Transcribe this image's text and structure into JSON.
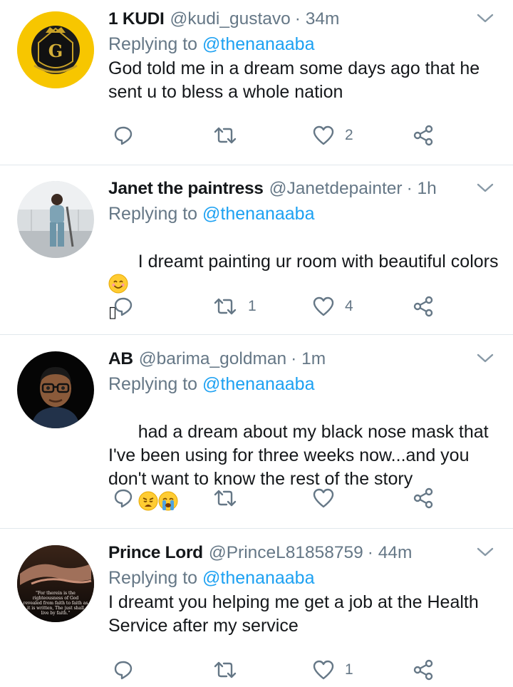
{
  "tweets": [
    {
      "name": "1 KUDI",
      "handle": "@kudi_gustavo",
      "time": "· 34m",
      "reply_prefix": "Replying to",
      "reply_to": "@thenanaaba",
      "text": "God told me in a dream some days ago that he sent u to bless a whole nation",
      "retweets": "",
      "likes": "2",
      "avatar": "gold-crest-logo"
    },
    {
      "name": "Janet the paintress",
      "handle": "@Janetdepainter",
      "time": "· 1h",
      "reply_prefix": "Replying to",
      "reply_to": "@thenanaaba",
      "text": "I dreamt painting ur room with beautiful colors",
      "text_tail": "▯",
      "retweets": "1",
      "likes": "4",
      "avatar": "person-photo"
    },
    {
      "name": "AB",
      "handle": "@barima_goldman",
      "time": "· 1m",
      "reply_prefix": "Replying to",
      "reply_to": "@thenanaaba",
      "text": "had a dream about my black nose mask that I've been using for three weeks now...and you don't want to know the rest of the story",
      "retweets": "",
      "likes": "",
      "avatar": "memoji"
    },
    {
      "name": "Prince Lord",
      "handle": "@PrinceL81858759",
      "time": "· 44m",
      "reply_prefix": "Replying to",
      "reply_to": "@thenanaaba",
      "text": "I dreamt you helping me get a job at the Health Service after my service",
      "retweets": "",
      "likes": "1",
      "avatar": "hands-scripture",
      "avatar_text": "\"For therein is the righteousness of God revealed from faith to faith as it is written, The just shall live by faith.\""
    }
  ],
  "icons": {
    "reply": "reply-icon",
    "retweet": "retweet-icon",
    "like": "heart-icon",
    "share": "share-icon",
    "more": "chevron-down-icon"
  },
  "colors": {
    "link": "#1da1f2",
    "muted": "#657786",
    "text": "#14171a",
    "divider": "#e1e8ed"
  }
}
